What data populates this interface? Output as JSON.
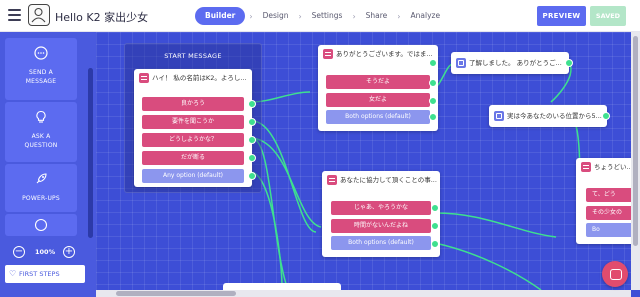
{
  "header": {
    "bot_name": "Hello K2 家出少女",
    "steps": [
      "Builder",
      "Design",
      "Settings",
      "Share",
      "Analyze"
    ],
    "active_step": "Builder",
    "preview_label": "PREVIEW",
    "saved_label": "SAVED"
  },
  "sidebar": {
    "tools": [
      {
        "label_lines": [
          "SEND A",
          "MESSAGE"
        ],
        "icon": "message-bubble-icon"
      },
      {
        "label_lines": [
          "ASK A",
          "QUESTION"
        ],
        "icon": "lightbulb-icon"
      },
      {
        "label_lines": [
          "POWER-UPS"
        ],
        "icon": "rocket-icon"
      }
    ],
    "zoom": "100%",
    "first_steps_label": "FIRST STEPS"
  },
  "canvas": {
    "start_label": "START MESSAGE",
    "start_card": {
      "text": "ハイ！ 私の名前はK2。よろし...",
      "options": [
        "良かろう",
        "要件を聞こうか",
        "どうしようかな？",
        "だが断る"
      ],
      "default_option": "Any option (default)"
    },
    "card_thanks": {
      "text": "ありがとうございます。ではま...",
      "options": [
        "そうだよ",
        "女だよ"
      ],
      "default_option": "Both options (default)"
    },
    "card_understood": {
      "text": "了解しました。 ありがとうご..."
    },
    "card_location": {
      "text": "実は今あなたのいる位置から5..."
    },
    "card_cooperate": {
      "text": "あなたに協力して頂くことの事...",
      "options": [
        "じゃあ、やろうかな",
        "時間がないんだよね"
      ],
      "default_option": "Both options (default)"
    },
    "card_edge": {
      "text": "ちょうどい...",
      "options": [
        "て、どう",
        "その少女の"
      ],
      "default_option": "Bo"
    }
  },
  "colors": {
    "canvas_bg": "#3d4ed6",
    "accent": "#5c6bf0",
    "option_pink": "#d94c7e",
    "option_default": "#8c96ee",
    "connector": "#3ee08f"
  }
}
